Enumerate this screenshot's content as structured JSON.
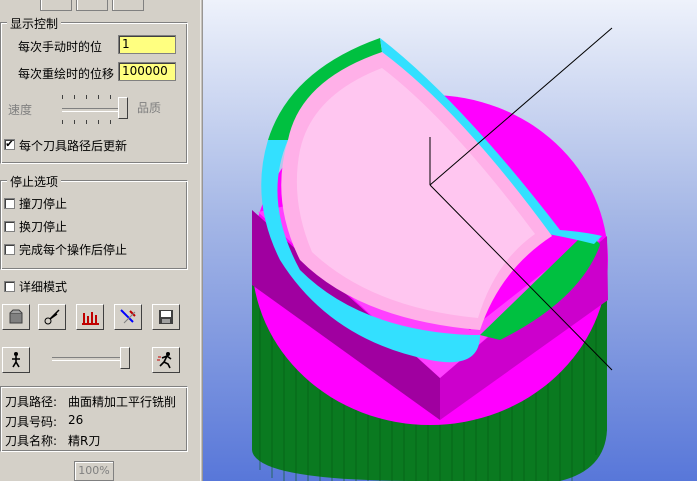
{
  "display_control": {
    "title": "显示控制",
    "step_label": "每次手动时的位",
    "step_value": "1",
    "redraw_label": "每次重绘时的位移",
    "redraw_value": "100000",
    "speed_label": "速度",
    "quality_label": "品质",
    "speed_quality_level": 1.0,
    "update_each_path_label": "每个刀具路径后更新",
    "update_each_path_checked": true
  },
  "stop_options": {
    "title": "停止选项",
    "items": [
      {
        "label": "撞刀停止",
        "checked": false
      },
      {
        "label": "换刀停止",
        "checked": false
      },
      {
        "label": "完成每个操作后停止",
        "checked": false
      }
    ]
  },
  "verbose_mode": {
    "label": "详细模式",
    "checked": false
  },
  "toolbar_icons": [
    "stock-icon",
    "tool-cut-icon",
    "chart-bars-icon",
    "pin-icon",
    "save-icon"
  ],
  "playback": {
    "step_icon": "walk-icon",
    "run_icon": "run-icon",
    "speed_level": 1.0
  },
  "tool_info": {
    "path_label": "刀具路径:",
    "path_value": "曲面精加工平行铣削",
    "number_label": "刀具号码:",
    "number_value": "26",
    "name_label": "刀具名称:",
    "name_value": "精R刀"
  },
  "progress": {
    "text": "100%",
    "value": 1.0
  },
  "colors": {
    "panel": "#d4d0c8",
    "input_highlight": "#ffff80",
    "part_magenta": "#ff00ff",
    "part_green": "#00c040",
    "part_cyan": "#33e0ff",
    "part_pink": "#ffb0e8",
    "stock_dark_green": "#0a7a20"
  }
}
